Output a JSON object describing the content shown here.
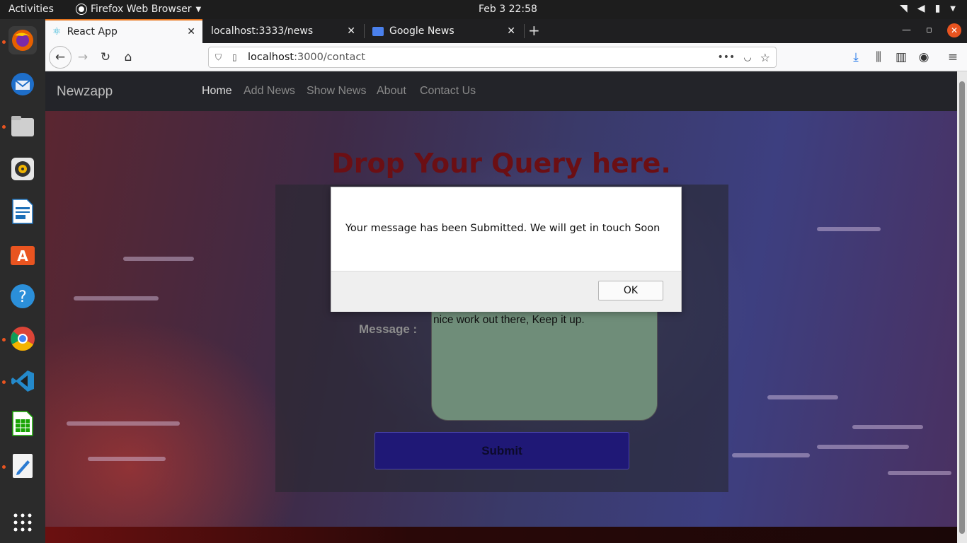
{
  "topbar": {
    "activities": "Activities",
    "app_menu": "Firefox Web Browser",
    "clock": "Feb 3  22:58"
  },
  "dock": {
    "items": [
      "firefox-icon",
      "thunderbird-icon",
      "files-icon",
      "rhythmbox-icon",
      "writer-icon",
      "software-center-icon",
      "help-icon",
      "chrome-icon",
      "vscode-icon",
      "calc-icon",
      "text-editor-icon",
      "show-apps-icon"
    ]
  },
  "browser": {
    "tabs": [
      {
        "label": "React App",
        "active": true
      },
      {
        "label": "localhost:3333/news",
        "active": false
      },
      {
        "label": "Google News",
        "active": false
      }
    ],
    "url_host": "localhost",
    "url_path": ":3000/contact"
  },
  "app": {
    "brand": "Newzapp",
    "nav": [
      "Home",
      "Add News",
      "Show News",
      "About",
      "Contact Us"
    ],
    "heading": "Drop Your Query here.",
    "message_label": "Message :",
    "message_value": "nice work out there, Keep it up.",
    "submit_label": "Submit"
  },
  "dialog": {
    "message": "Your message has been Submitted. We will get in touch Soon",
    "ok_label": "OK"
  },
  "colors": {
    "heading": "#6b0f14",
    "submit_bg": "#1f1876",
    "textarea_bg": "#6f8d79",
    "accent_tab": "#e7761f"
  }
}
